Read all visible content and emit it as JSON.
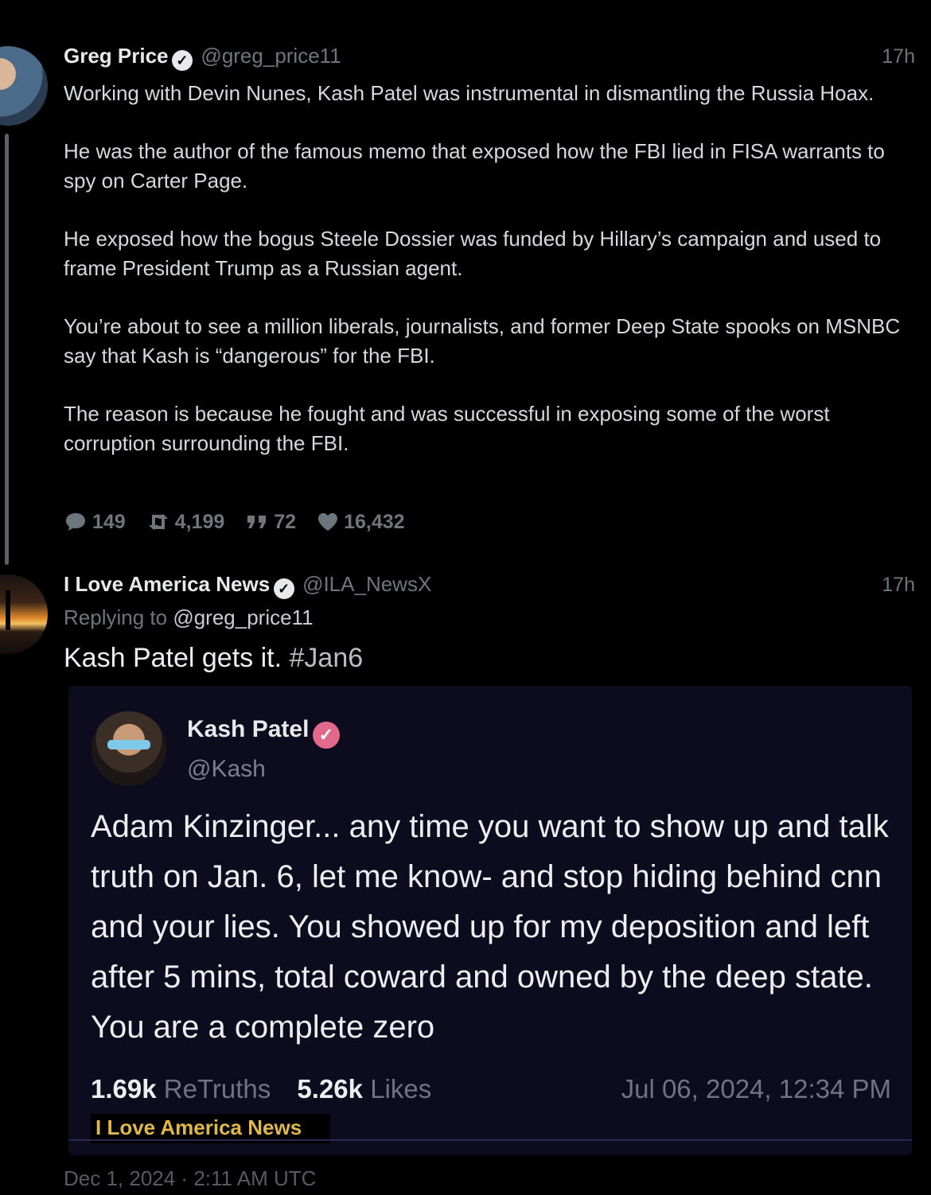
{
  "tweet1": {
    "name": "Greg Price",
    "handle": "@greg_price11",
    "time": "17h",
    "paragraphs": [
      "Working with Devin Nunes, Kash Patel was instrumental in dismantling the Russia Hoax.",
      "He was the author of the famous memo that exposed how the FBI lied in FISA warrants to spy on Carter Page.",
      "He exposed how the bogus Steele Dossier was funded by Hillary’s campaign and used to frame President Trump as a Russian agent.",
      "You’re about to see a million liberals, journalists, and former Deep State spooks on MSNBC say that Kash is “dangerous” for the FBI.",
      "The reason is because he fought and was successful in exposing some of the worst corruption surrounding the FBI."
    ],
    "stats": {
      "replies": "149",
      "retweets": "4,199",
      "quotes": "72",
      "likes": "16,432"
    }
  },
  "tweet2": {
    "name": "I Love America News",
    "handle": "@ILA_NewsX",
    "time": "17h",
    "replying_prefix": "Replying to",
    "replying_handle": "@greg_price11",
    "text": "Kash Patel gets it.",
    "hashtag": "#Jan6",
    "timestamp": "Dec 1, 2024 · 2:11 AM UTC"
  },
  "embedded": {
    "name": "Kash Patel",
    "handle": "@Kash",
    "text": "Adam Kinzinger... any time you want to show up and talk truth on Jan. 6, let me know- and stop hiding behind cnn and your lies. You showed up for my deposition and left after 5 mins, total coward and owned by the deep state. You are a complete zero",
    "retruths_count": "1.69k",
    "retruths_label": "ReTruths",
    "likes_count": "5.26k",
    "likes_label": "Likes",
    "date": "Jul 06, 2024, 12:34 PM",
    "watermark": "I Love America News"
  },
  "icons": {
    "reply": "comment-icon",
    "retweet": "retweet-icon",
    "quote": "quote-icon",
    "like": "heart-icon",
    "verified": "verified-badge-icon"
  },
  "colors": {
    "background": "#000000",
    "card": "#0d0c1e",
    "muted": "#6e767d",
    "kash_verified": "#e3698a",
    "watermark": "#e0b84a"
  }
}
